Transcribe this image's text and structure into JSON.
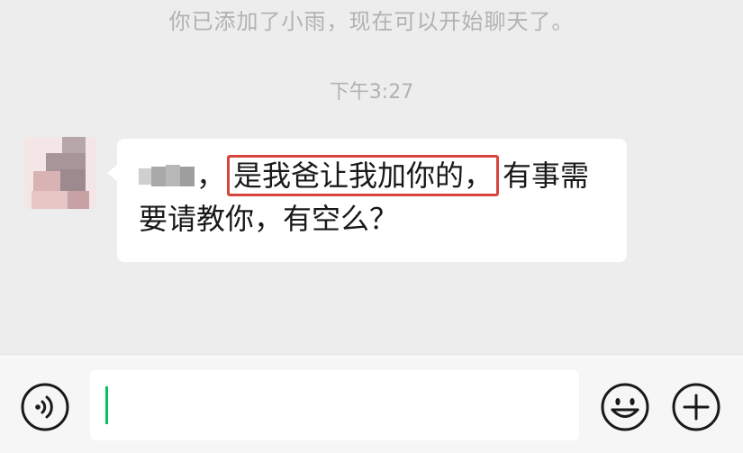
{
  "chat": {
    "system_notice": "你已添加了小雨，现在可以开始聊天了。",
    "timestamp": "下午3:27",
    "message": {
      "prefix_punct": "，",
      "highlighted": "是我爸让我加你的，",
      "line1_rest": "有事需",
      "line2": "要请教你，有空么？"
    }
  },
  "input_bar": {
    "voice_icon": "voice-icon",
    "emoji_icon": "emoji-icon",
    "plus_icon": "plus-icon",
    "text_value": ""
  },
  "colors": {
    "background": "#ededed",
    "bubble": "#ffffff",
    "highlight_border": "#d8453c",
    "caret": "#07c160",
    "meta_text": "#b2b2b2"
  }
}
